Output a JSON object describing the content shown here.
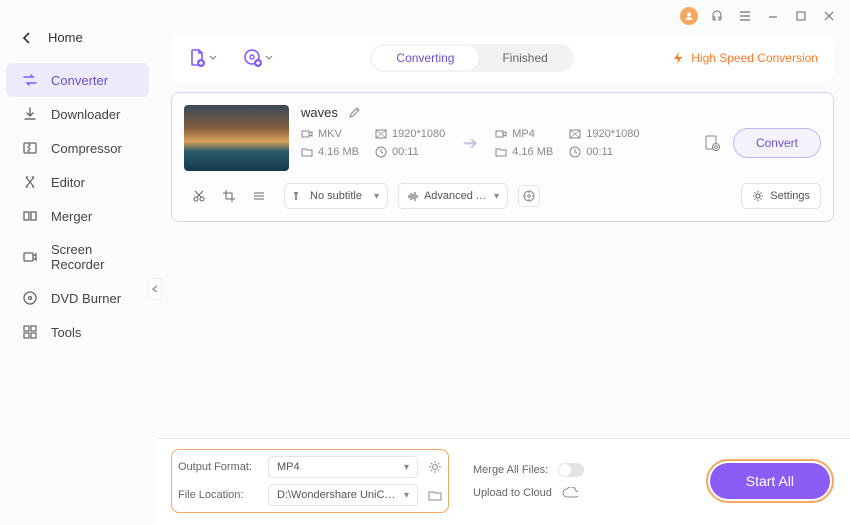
{
  "sidebar": {
    "home": "Home",
    "items": [
      {
        "label": "Converter"
      },
      {
        "label": "Downloader"
      },
      {
        "label": "Compressor"
      },
      {
        "label": "Editor"
      },
      {
        "label": "Merger"
      },
      {
        "label": "Screen Recorder"
      },
      {
        "label": "DVD Burner"
      },
      {
        "label": "Tools"
      }
    ]
  },
  "tabs": {
    "converting": "Converting",
    "finished": "Finished"
  },
  "hsc": "High Speed Conversion",
  "file": {
    "name": "waves",
    "src": {
      "format": "MKV",
      "resolution": "1920*1080",
      "size": "4.16 MB",
      "duration": "00:11"
    },
    "dst": {
      "format": "MP4",
      "resolution": "1920*1080",
      "size": "4.16 MB",
      "duration": "00:11"
    },
    "subtitle": "No subtitle",
    "audio": "Advanced Audi...",
    "settings": "Settings",
    "convert": "Convert"
  },
  "footer": {
    "output_label": "Output Format:",
    "output_value": "MP4",
    "location_label": "File Location:",
    "location_value": "D:\\Wondershare UniConverter 1",
    "merge": "Merge All Files:",
    "upload": "Upload to Cloud",
    "start": "Start All"
  }
}
